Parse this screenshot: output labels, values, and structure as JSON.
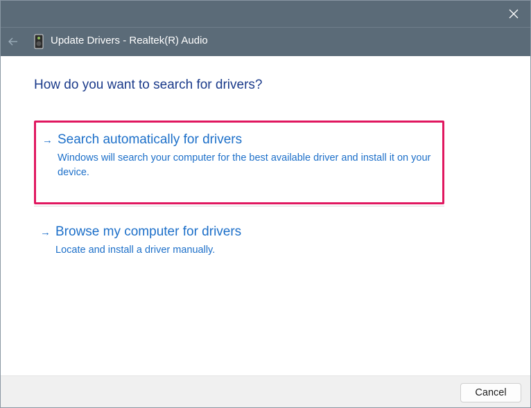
{
  "window": {
    "header_title": "Update Drivers - Realtek(R) Audio",
    "close_icon": "close-icon",
    "back_icon": "back-arrow-icon",
    "device_icon": "speaker-device-icon"
  },
  "main": {
    "question": "How do you want to search for drivers?",
    "options": [
      {
        "arrow": "→",
        "title": "Search automatically for drivers",
        "description": "Windows will search your computer for the best available driver and install it on your device.",
        "highlighted": true
      },
      {
        "arrow": "→",
        "title": "Browse my computer for drivers",
        "description": "Locate and install a driver manually.",
        "highlighted": false
      }
    ]
  },
  "footer": {
    "cancel_label": "Cancel"
  },
  "colors": {
    "titlebar": "#5b6b78",
    "link_blue": "#1c6fc9",
    "heading_blue": "#1a3a8a",
    "highlight_border": "#e0175f"
  }
}
